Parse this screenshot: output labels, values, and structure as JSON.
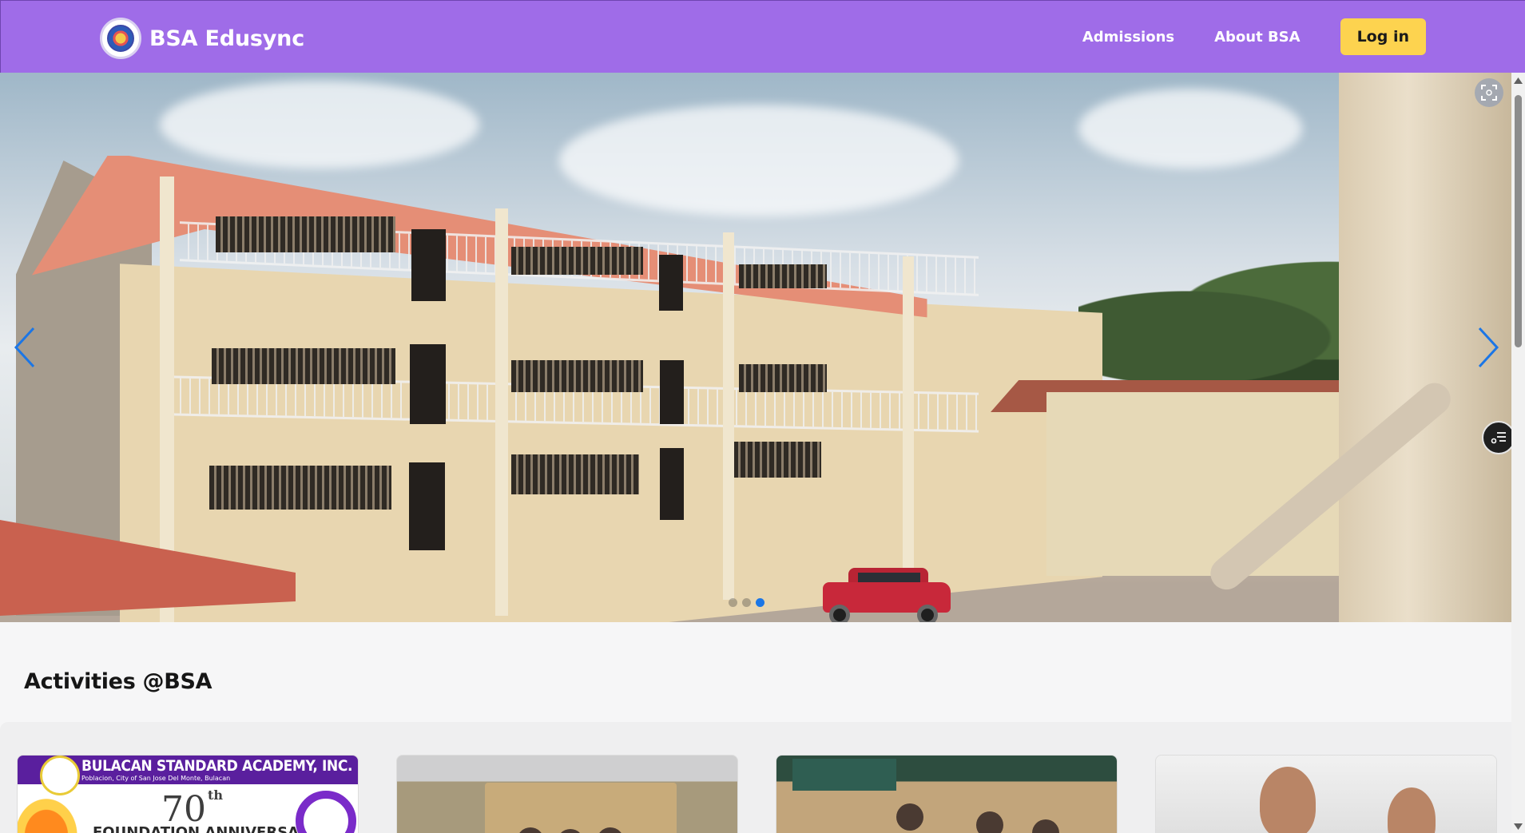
{
  "header": {
    "brand_name": "BSA Edusync",
    "nav": {
      "admissions": "Admissions",
      "about": "About BSA",
      "login": "Log in"
    },
    "brand_color": "#9f6ce8",
    "login_color": "#fdd34f"
  },
  "carousel": {
    "slide_count": 3,
    "active_slide": 3,
    "prev_icon": "chevron-left-icon",
    "next_icon": "chevron-right-icon",
    "accent_color": "#1b76e6"
  },
  "activities": {
    "title": "Activities @BSA",
    "cards": [
      {
        "header": "BULACAN STANDARD ACADEMY, INC.",
        "subheader": "Poblacion, City of San Jose Del Monte, Bulacan",
        "number": "70",
        "number_suffix": "th",
        "caption": "FOUNDATION ANNIVERSARY"
      },
      {
        "kind": "photo"
      },
      {
        "kind": "photo"
      },
      {
        "kind": "photo"
      }
    ]
  }
}
